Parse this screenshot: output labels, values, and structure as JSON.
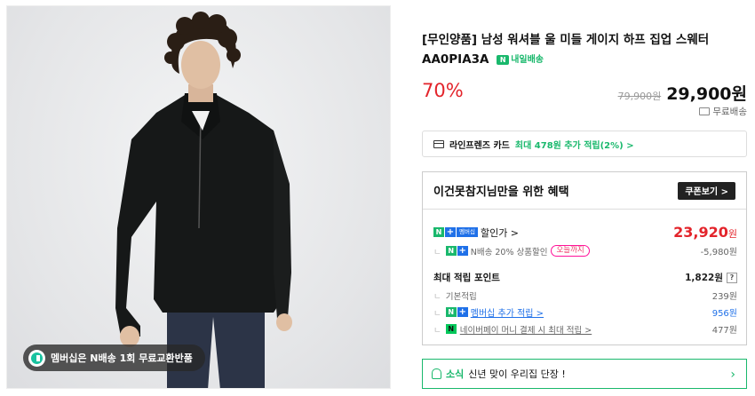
{
  "image": {
    "member_badge": "멤버십은 N배송 1회 무료교환반품"
  },
  "product": {
    "title": "[무인양품] 남성 워셔블 울 미들 게이지 하프 집업 스웨터 AA0PIA3A",
    "delivery_badge": "내일배송",
    "discount": "70%",
    "original_price": "79,900원",
    "sale_price": "29,900원",
    "shipping": "무료배송"
  },
  "card_promo": {
    "lead": "라인프렌즈 카드",
    "text": "최대 478원 추가 적립(2%) >"
  },
  "benefit": {
    "title": "이건못참지님만을 위한 혜택",
    "coupon_button": "쿠폰보기 >",
    "member_price_label": "할인가 >",
    "member_price": "23,920",
    "member_price_unit": "원",
    "n_discount_label": "N배송 20% 상품할인",
    "today_only": "오늘까지",
    "n_discount_value": "-5,980원",
    "points_label": "최대 적립 포인트",
    "points_value": "1,822원",
    "basic_label": "기본적립",
    "basic_value": "239원",
    "membership_label": "멤버십 추가 적립 >",
    "membership_value": "956원",
    "npay_label": "네이버페이 머니 결제 시 최대 적립 >",
    "npay_value": "477원"
  },
  "news": {
    "tag": "소식",
    "text": "신년 맞이 우리집 단장 !"
  },
  "colors": {
    "accent_green": "#19b86c",
    "sale_red": "#e3242b",
    "naver_blue": "#1f70e8"
  }
}
